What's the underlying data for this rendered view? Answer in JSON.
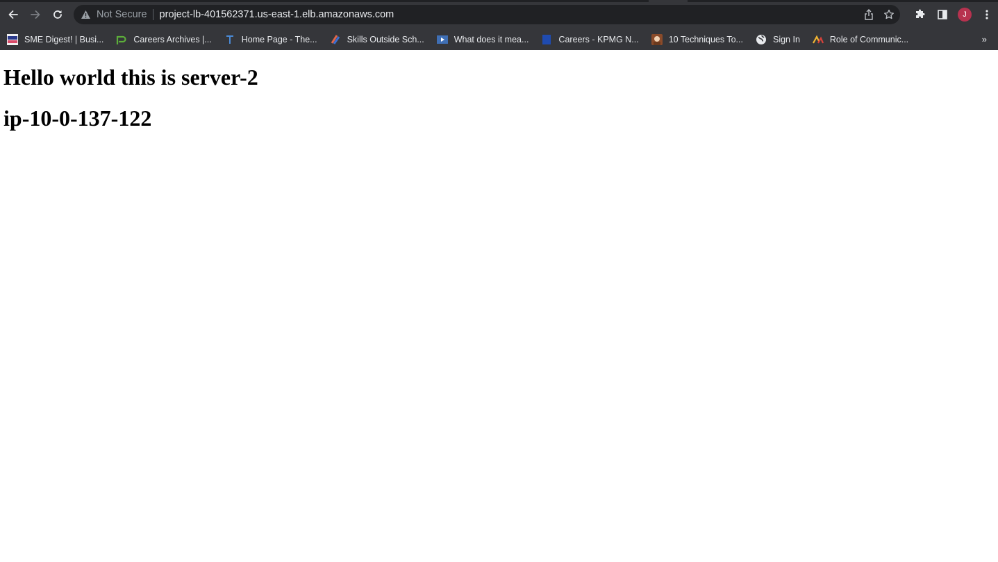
{
  "browser": {
    "security_label": "Not Secure",
    "url": "project-lb-401562371.us-east-1.elb.amazonaws.com",
    "profile_initial": "J",
    "profile_color": "#b7324f"
  },
  "bookmarks": [
    {
      "label": "SME Digest! | Busi...",
      "icon": "sme-digest-favicon"
    },
    {
      "label": "Careers Archives |...",
      "icon": "green-p-favicon"
    },
    {
      "label": "Home Page - The...",
      "icon": "blue-t-favicon"
    },
    {
      "label": "Skills Outside Sch...",
      "icon": "skills-favicon"
    },
    {
      "label": "What does it mea...",
      "icon": "video-favicon"
    },
    {
      "label": "Careers - KPMG N...",
      "icon": "kpmg-favicon"
    },
    {
      "label": "10 Techniques To...",
      "icon": "portrait-favicon"
    },
    {
      "label": "Sign In",
      "icon": "globe-favicon"
    },
    {
      "label": "Role of Communic...",
      "icon": "communic-favicon"
    }
  ],
  "bookmarks_overflow": "»",
  "page": {
    "heading1": "Hello world this is server-2",
    "heading2": "ip-10-0-137-122"
  }
}
